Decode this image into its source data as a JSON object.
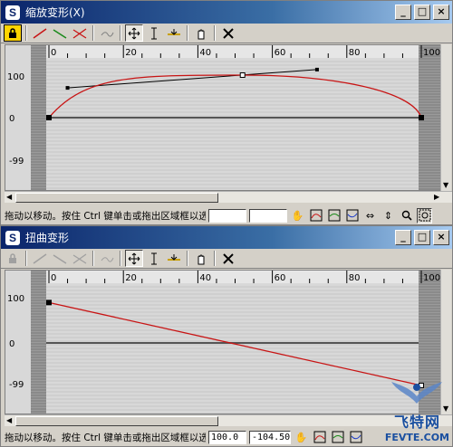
{
  "windows": [
    {
      "title": "缩放变形(X)",
      "app_icon": "S",
      "caption_buttons": [
        "_",
        "□",
        "×"
      ],
      "ruler_ticks": [
        "0",
        "20",
        "40",
        "60",
        "80",
        "100"
      ],
      "y_labels": [
        "100",
        "0",
        "-99"
      ],
      "status_text": "拖动以移动。按住 Ctrl 键单击或拖出区域框以选",
      "field1_value": "",
      "field2_value": "",
      "curve": {
        "start": [
          0,
          0
        ],
        "peak": [
          52,
          100
        ],
        "end": [
          100,
          0
        ],
        "handle_left": [
          5,
          70
        ],
        "handle_right": [
          72,
          113
        ],
        "curve_color": "#c81414"
      }
    },
    {
      "title": "扭曲变形",
      "app_icon": "S",
      "caption_buttons": [
        "_",
        "□",
        "×"
      ],
      "ruler_ticks": [
        "0",
        "20",
        "40",
        "60",
        "80",
        "100"
      ],
      "y_labels": [
        "100",
        "0",
        "-99"
      ],
      "status_text": "拖动以移动。按住 Ctrl 键单击或拖出区域框以选",
      "field1_value": "100.0",
      "field2_value": "-104.505",
      "curve": {
        "start": [
          0,
          95
        ],
        "end": [
          100,
          -100
        ],
        "curve_color": "#c81414"
      }
    }
  ],
  "watermark": {
    "text": "飞特网",
    "sub": "FEVTE.COM"
  },
  "colors": {
    "title_active": "#0a246a",
    "plot_bg": "#d8d8d8",
    "gridline": "#bfbfbf",
    "curve": "#c81414"
  }
}
